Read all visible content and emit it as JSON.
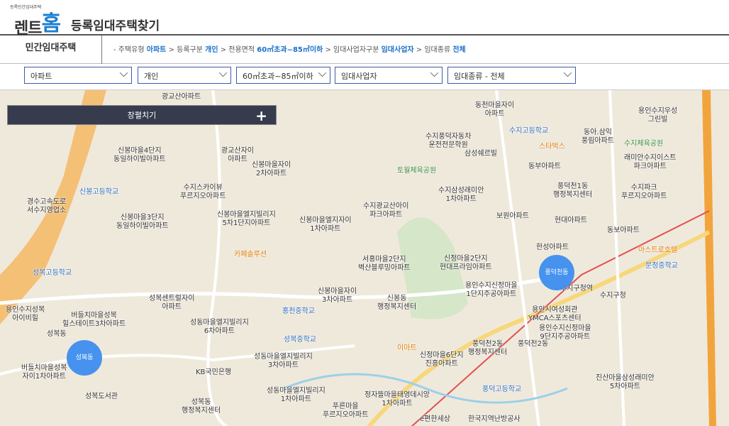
{
  "header": {
    "small_text": "등록민간임대주택",
    "logo_left": "렌트",
    "logo_right": "홈",
    "title": "등록임대주택찾기"
  },
  "breadcrumb": {
    "title": "민간임대주택",
    "items": [
      {
        "label": "- 주택유형 ",
        "value": "아파트"
      },
      {
        "label": " > 등록구분 ",
        "value": "개인"
      },
      {
        "label": " > 전용면적 ",
        "value": "60㎡초과~85㎡이하"
      },
      {
        "label": " > 임대사업자구분 ",
        "value": "임대사업자"
      },
      {
        "label": " > 임대종류 ",
        "value": "전체"
      }
    ]
  },
  "filters": [
    "아파트",
    "개인",
    "60㎡초과~85㎡이하",
    "임대사업자",
    "임대종류 - 전체"
  ],
  "panel": {
    "label": "창펼치기",
    "toggle": "+"
  },
  "map": {
    "clusters": [
      "풍덕천동",
      "성복동"
    ],
    "labels": [
      "광교산아파트",
      "동천마을자이\n아파트",
      "수지풍덕자동차\n운전전문학원",
      "수지고등학교",
      "동아.삼익\n풍림아파트",
      "용인수지우성\n그린빌",
      "신봉마을4단지\n동일하이빌아파트",
      "광교산자이\n아파트",
      "신봉마을자이\n2차아파트",
      "삼성쉐르빌",
      "스타벅스",
      "수지체육공원",
      "래미안수지이스트\n파크아파트",
      "신봉고등학교",
      "수지스카이뷰\n푸르지오아파트",
      "토월체육공원",
      "동부아파트",
      "풍덕천1동\n행정복지센터",
      "수지파크\n푸르지오아파트",
      "경수고속도로\n서수지영업소",
      "신봉마을3단지\n동일하이빌아파트",
      "신봉마을엘지빌리지\n5차1단지아파트",
      "신봉마을엘지자이\n1차아파트",
      "수지광교산아이\n파크아파트",
      "수지삼성래미안\n1차아파트",
      "보원아파트",
      "현대아파트",
      "동보아파트",
      "카페솔루션",
      "한성아파트",
      "아스트로호텔",
      "성복고등학교",
      "서홍마을2단지\n벽산블루밍아파트",
      "신정마을2단지\n현대프라임아파트",
      "문정중학교",
      "성복센트럴자이\n아파트",
      "용인수지성복\n아이비힐",
      "신봉마을자이\n3차아파트",
      "용인수지신정마을\n1단지주공아파트",
      "수지구청역",
      "수지구청",
      "버들치마을성복\n힐스테이트3차아파트",
      "성동마을엘지빌리지\n6차아파트",
      "홍천중학교",
      "신봉동\n행정복지센터",
      "용인시여성회관\nYMCA스포츠센터",
      "성복동",
      "성복중학교",
      "이마트",
      "풍덕천2동",
      "버들치마을성복\n자이1차아파트",
      "성동마을엘지빌리지\n3차아파트",
      "신정마을6단지\n진흥아파트",
      "풍덕천2동\n행정복지센터",
      "KB국민은행",
      "용인수지신정마을\n9단지주공아파트",
      "성복동\n행정복지센터",
      "성동마을엘지빌리지\n1차아파트",
      "정자뜰마을태영데시앙\n1차아파트",
      "풍덕고등학교",
      "진산마을삼성래미안\n5차아파트",
      "성복도서관",
      "푸른마을\n푸르지오아파트",
      "e편한세상",
      "한국지역난방공사"
    ]
  }
}
